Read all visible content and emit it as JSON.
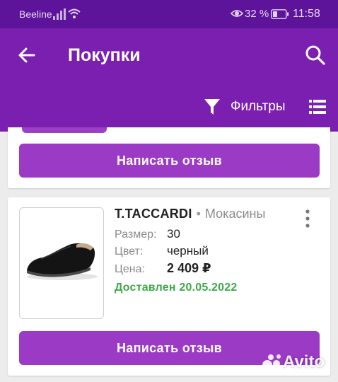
{
  "status_bar": {
    "carrier": "Beeline",
    "battery_percent": "32 %",
    "time": "11:58"
  },
  "app_bar": {
    "title": "Покупки",
    "filter_label": "Фильтры"
  },
  "orders": [
    {
      "review_button": "Написать отзыв"
    },
    {
      "brand": "T.TACCARDI",
      "separator": "•",
      "category": "Мокасины",
      "specs": {
        "size_label": "Размер:",
        "size_value": "30",
        "color_label": "Цвет:",
        "color_value": "черный",
        "price_label": "Цена:",
        "price_value": "2 409 ₽"
      },
      "status": "Доставлен 20.05.2022",
      "review_button": "Написать отзыв"
    }
  ],
  "watermark": "Avito",
  "colors": {
    "status_bar": "#5e139b",
    "app_bar": "#7b1fb0",
    "button": "#9b3ac5",
    "delivered": "#3fa84a"
  }
}
